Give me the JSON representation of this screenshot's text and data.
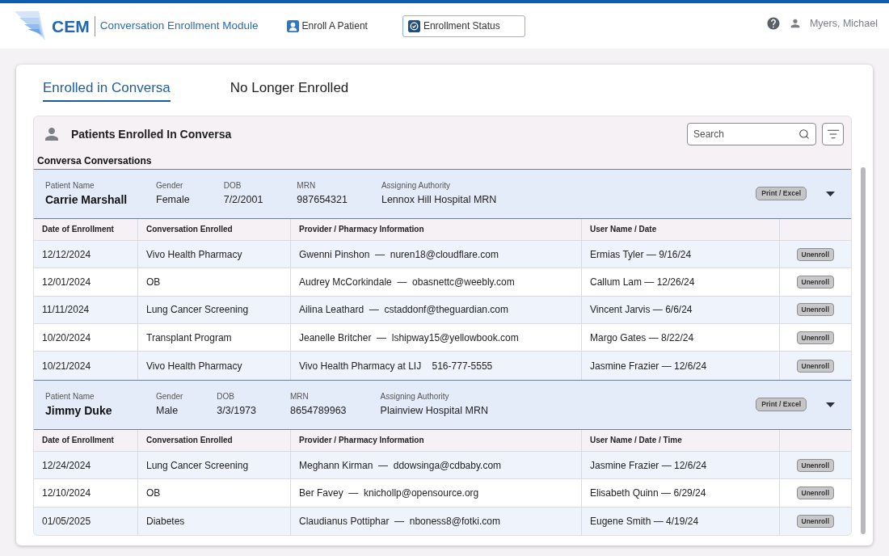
{
  "header": {
    "logo_text": "CEM",
    "module_title": "Conversation Enrollment Module",
    "nav": [
      {
        "label": "Enroll A Patient",
        "kind": "enroll",
        "selected": false
      },
      {
        "label": "Enrollment Status",
        "kind": "status",
        "selected": true
      }
    ],
    "user": "Myers, Michael"
  },
  "tabs": [
    {
      "label": "Enrolled in Conversa",
      "selected": true
    },
    {
      "label": "No Longer Enrolled",
      "selected": false
    }
  ],
  "panel": {
    "title": "Patients Enrolled In Conversa",
    "search": {
      "placeholder": "Search"
    },
    "section_title": "Conversa Conversations",
    "patients": [
      {
        "fields": [
          {
            "label": "Patient Name",
            "value": "Carrie Marshall"
          },
          {
            "label": "Gender",
            "value": "Female"
          },
          {
            "label": "DOB",
            "value": "7/2/2001"
          },
          {
            "label": "MRN",
            "value": "987654321"
          },
          {
            "label": "Assigning Authority",
            "value": "Lennox Hill Hospital MRN"
          }
        ],
        "print_button": "Print / Excel",
        "expanded": true,
        "columns": [
          "Date of Enrollment",
          "Conversation Enrolled",
          "Provider / Pharmacy Information",
          "User Name / Date"
        ],
        "rows": [
          {
            "cells": [
              "12/12/2024",
              "Vivo Health Pharmacy",
              "Gwenni Pinshon  —  nuren18@cloudflare.com",
              "Ermias Tyler — 9/16/24"
            ],
            "action": "Unenroll"
          },
          {
            "cells": [
              "12/01/2024",
              "OB",
              "Audrey McCorkindale  —  obasnettc@weebly.com",
              "Callum Lam — 12/26/24"
            ],
            "action": "Unenroll"
          },
          {
            "cells": [
              "11/11/2024",
              "Lung Cancer Screening",
              "Ailina Leathard  —  cstaddonf@theguardian.com",
              "Vincent Jarvis — 6/6/24"
            ],
            "action": "Unenroll"
          },
          {
            "cells": [
              "10/20/2024",
              "Transplant Program",
              "Jeanelle Britcher  —  lshipway15@yellowbook.com",
              "Margo Gates — 8/22/24"
            ],
            "action": "Unenroll"
          },
          {
            "cells": [
              "10/21/2024",
              "Vivo Health Pharmacy",
              "Vivo Health Pharmacy at LIJ    516-777-5555",
              "Jasmine Frazier — 12/6/24"
            ],
            "action": "Unenroll"
          }
        ]
      },
      {
        "fields": [
          {
            "label": "Patient Name",
            "value": "Jimmy Duke"
          },
          {
            "label": "Gender",
            "value": "Male"
          },
          {
            "label": "DOB",
            "value": "3/3/1973"
          },
          {
            "label": "MRN",
            "value": "8654789963"
          },
          {
            "label": "Assigning Authority",
            "value": "Plainview Hospital MRN"
          }
        ],
        "print_button": "Print / Excel",
        "expanded": true,
        "columns": [
          "Date of Enrollment",
          "Conversation Enrolled",
          "Provider / Pharmacy Information",
          "User Name / Date / Time"
        ],
        "rows": [
          {
            "cells": [
              "12/24/2024",
              "Lung Cancer Screening",
              "Meghann Kirman  —  ddowsinga@cdbaby.com",
              "Jasmine Frazier — 12/6/24"
            ],
            "action": "Unenroll"
          },
          {
            "cells": [
              "12/10/2024",
              "OB",
              "Ber Favey  —  knichollp@opensource.org",
              "Elisabeth Quinn — 6/29/24"
            ],
            "action": "Unenroll"
          },
          {
            "cells": [
              "01/05/2025",
              "Diabetes",
              "Claudianus Pottiphar  —  nboness8@fotki.com",
              "Eugene Smith — 4/19/24"
            ],
            "action": "Unenroll"
          }
        ]
      }
    ]
  }
}
